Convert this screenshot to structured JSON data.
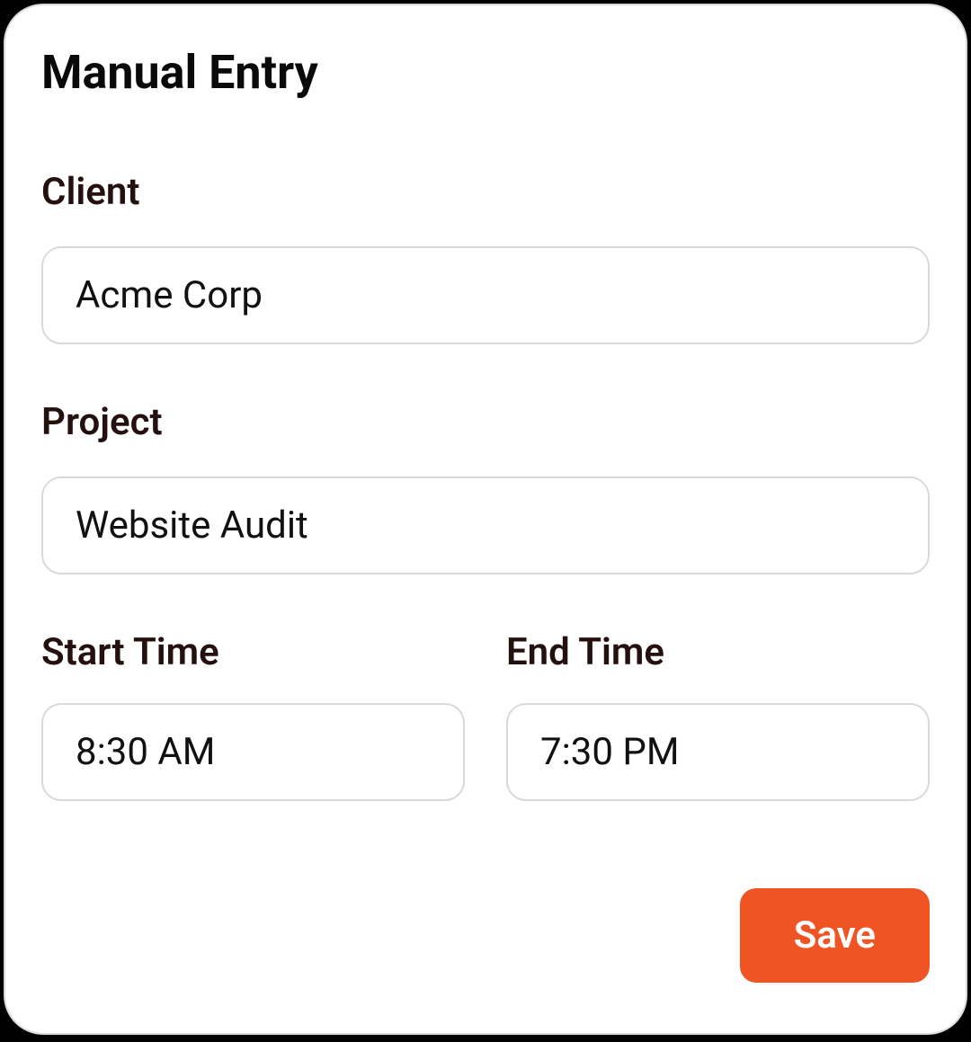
{
  "title": "Manual Entry",
  "fields": {
    "client": {
      "label": "Client",
      "value": "Acme Corp"
    },
    "project": {
      "label": "Project",
      "value": "Website Audit"
    },
    "start_time": {
      "label": "Start Time",
      "value": "8:30 AM"
    },
    "end_time": {
      "label": "End Time",
      "value": "7:30 PM"
    }
  },
  "actions": {
    "save_label": "Save"
  },
  "colors": {
    "accent": "#f05423",
    "label_text": "#23100f",
    "border": "#d9d9d9"
  }
}
